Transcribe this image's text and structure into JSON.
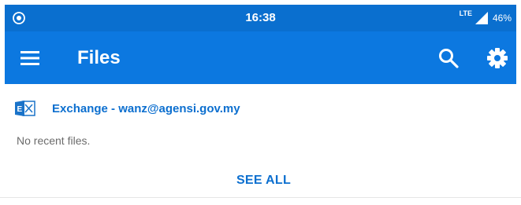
{
  "status_bar": {
    "time": "16:38",
    "network": "LTE",
    "battery": "46%",
    "left_icon": "radio-target-icon",
    "signal_icon": "signal-icon"
  },
  "app_bar": {
    "title": "Files",
    "menu_icon": "hamburger-menu-icon",
    "search_icon": "search-icon",
    "settings_icon": "gear-icon"
  },
  "account": {
    "icon": "exchange-icon",
    "label": "Exchange - wanz@agensi.gov.my"
  },
  "content": {
    "empty_message": "No recent files.",
    "see_all_label": "SEE ALL"
  },
  "colors": {
    "status_bar": "#0a6fcf",
    "app_bar": "#0c78e0",
    "accent": "#0c6fcf",
    "muted_text": "#6b6b6b"
  }
}
